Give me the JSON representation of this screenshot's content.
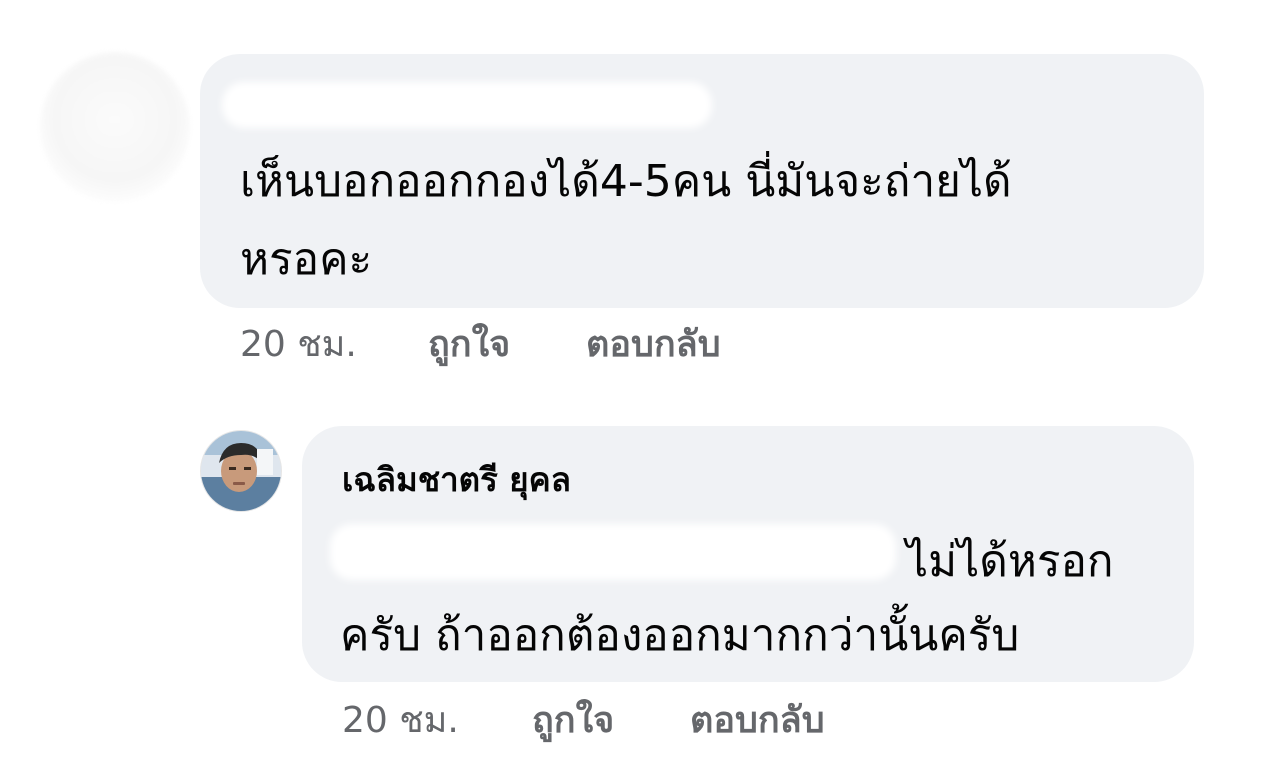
{
  "comments": [
    {
      "author": "",
      "text_line1": "เห็นบอกออกกองได้4-5คน  นี่มันจะถ่ายได้",
      "text_line2": "หรอคะ",
      "time": "20 ชม.",
      "like_label": "ถูกใจ",
      "reply_label": "ตอบกลับ"
    },
    {
      "author": "เฉลิมชาตรี ยุคล",
      "text_line1": "ไม่ได้หรอก",
      "text_line2": "ครับ ถ้าออกต้องออกมากกว่านั้นครับ",
      "time": "20 ชม.",
      "like_label": "ถูกใจ",
      "reply_label": "ตอบกลับ"
    }
  ],
  "colors": {
    "bubble": "#f0f2f5",
    "text": "#050505",
    "meta": "#65676b"
  }
}
